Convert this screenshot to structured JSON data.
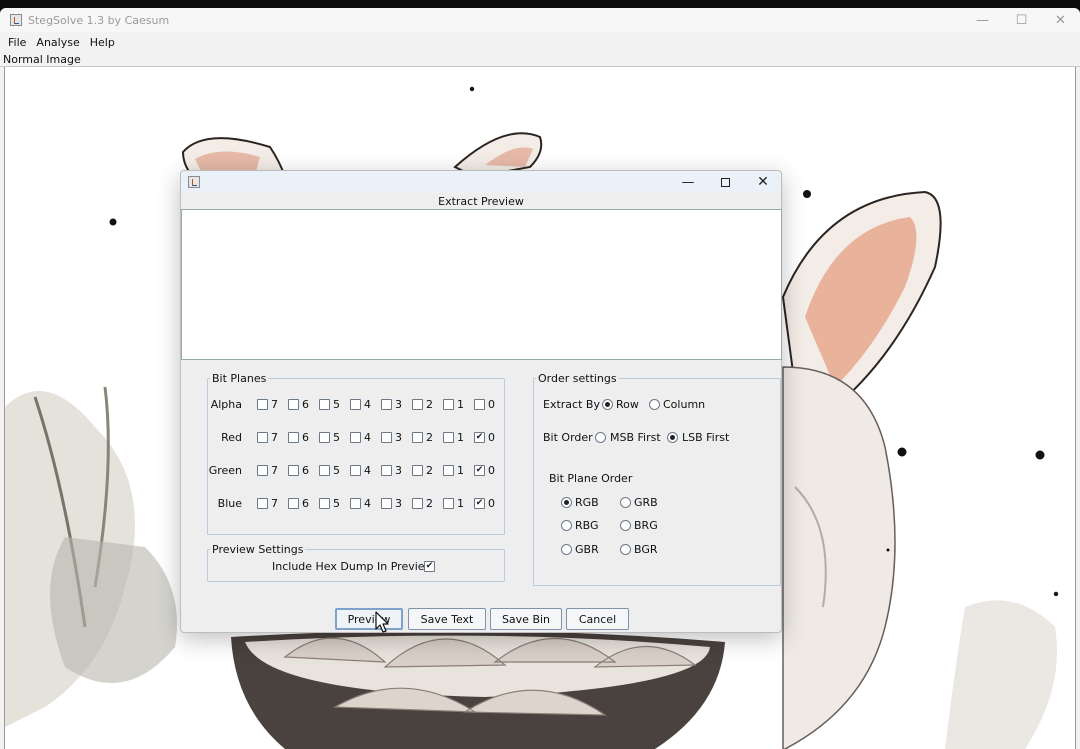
{
  "app": {
    "title": "StegSolve 1.3 by Caesum",
    "window_controls": [
      "—",
      "☐",
      "✕"
    ],
    "menu": [
      "File",
      "Analyse",
      "Help"
    ],
    "image_label": "Normal Image"
  },
  "dialog": {
    "title": "",
    "heading": "Extract Preview",
    "preview_text": "",
    "window_controls": {
      "minimize": "—",
      "close": "✕"
    },
    "bit_planes": {
      "legend": "Bit Planes",
      "bits": [
        "7",
        "6",
        "5",
        "4",
        "3",
        "2",
        "1",
        "0"
      ],
      "rows": [
        {
          "label": "Alpha",
          "checked": [
            false,
            false,
            false,
            false,
            false,
            false,
            false,
            false
          ]
        },
        {
          "label": "Red",
          "checked": [
            false,
            false,
            false,
            false,
            false,
            false,
            false,
            true
          ]
        },
        {
          "label": "Green",
          "checked": [
            false,
            false,
            false,
            false,
            false,
            false,
            false,
            true
          ]
        },
        {
          "label": "Blue",
          "checked": [
            false,
            false,
            false,
            false,
            false,
            false,
            false,
            true
          ]
        }
      ]
    },
    "preview_settings": {
      "legend": "Preview Settings",
      "hex_dump_label": "Include Hex Dump In Preview",
      "hex_dump_checked": true
    },
    "order_settings": {
      "legend": "Order settings",
      "extract_by_label": "Extract By",
      "extract_by_options": [
        "Row",
        "Column"
      ],
      "extract_by_selected": "Row",
      "bit_order_label": "Bit Order",
      "bit_order_options": [
        "MSB First",
        "LSB First"
      ],
      "bit_order_selected": "LSB First",
      "bit_plane_order_label": "Bit Plane Order",
      "bit_plane_order_options": [
        "RGB",
        "GRB",
        "RBG",
        "BRG",
        "GBR",
        "BGR"
      ],
      "bit_plane_order_selected": "RGB"
    },
    "buttons": [
      "Preview",
      "Save Text",
      "Save Bin",
      "Cancel"
    ],
    "check_glyph": "✔"
  },
  "colors": {
    "dialog_bg": "#eeeeee",
    "group_border": "#b9cbe0",
    "button_border": "#7f93ab"
  }
}
